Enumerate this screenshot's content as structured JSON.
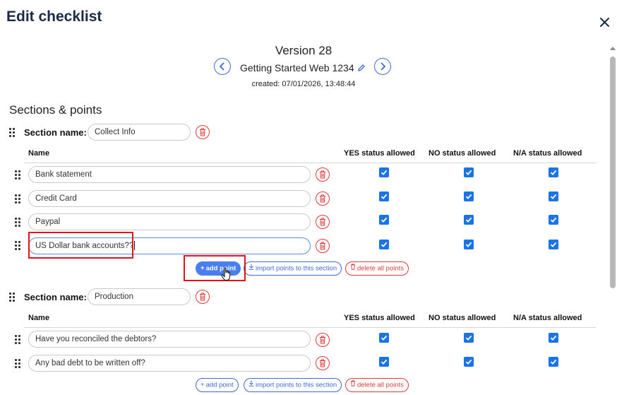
{
  "modal": {
    "title": "Edit checklist",
    "close_icon": "close-icon"
  },
  "header": {
    "version": "Version 28",
    "checklist_name": "Getting Started Web 1234",
    "created": "created: 07/01/2026, 13:48:44"
  },
  "sections_title": "Sections & points",
  "section_label": "Section name:",
  "columns": {
    "name": "Name",
    "yes": "YES status allowed",
    "no": "NO status allowed",
    "na": "N/A status allowed"
  },
  "buttons": {
    "add_point": "add point",
    "import_points": "import points to this section",
    "delete_all": "delete all points"
  },
  "sections": [
    {
      "name": "Collect Info",
      "points": [
        {
          "name": "Bank statement",
          "yes": true,
          "no": true,
          "na": true
        },
        {
          "name": "Credit Card",
          "yes": true,
          "no": true,
          "na": true
        },
        {
          "name": "Paypal",
          "yes": true,
          "no": true,
          "na": true
        },
        {
          "name": "US Dollar bank accounts??",
          "yes": true,
          "no": true,
          "na": true
        }
      ]
    },
    {
      "name": "Production",
      "points": [
        {
          "name": "Have you reconciled the debtors?",
          "yes": true,
          "no": true,
          "na": true
        },
        {
          "name": "Any bad debt to be written off?",
          "yes": true,
          "no": true,
          "na": true
        }
      ]
    }
  ],
  "colors": {
    "accent": "#3d6ad6",
    "checkbox": "#1a73e8",
    "danger": "#e03a3a",
    "highlight": "#e0151b",
    "title": "#1c2a4a"
  }
}
